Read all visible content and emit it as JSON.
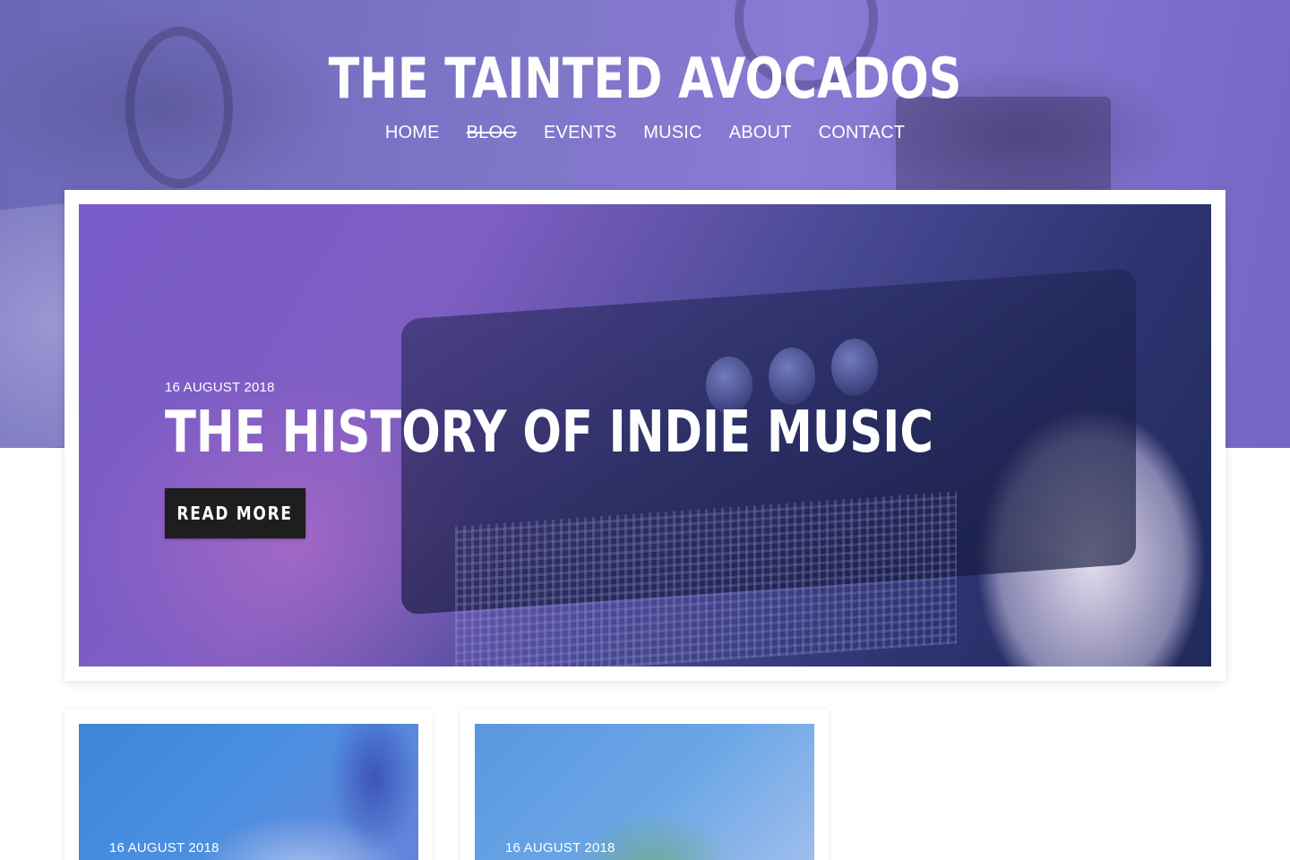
{
  "site": {
    "title": "THE TAINTED AVOCADOS"
  },
  "nav": {
    "items": [
      {
        "label": "HOME"
      },
      {
        "label": "BLOG",
        "current": true
      },
      {
        "label": "EVENTS"
      },
      {
        "label": "MUSIC"
      },
      {
        "label": "ABOUT"
      },
      {
        "label": "CONTACT"
      }
    ]
  },
  "featured_post": {
    "date": "16 AUGUST 2018",
    "title": "THE HISTORY OF INDIE MUSIC",
    "button_label": "READ MORE"
  },
  "posts": [
    {
      "date": "16 AUGUST 2018"
    },
    {
      "date": "16 AUGUST 2018"
    }
  ],
  "colors": {
    "hero_overlay": "#7f76c9",
    "button_bg": "#1e1e1e",
    "text_on_image": "#ffffff"
  }
}
